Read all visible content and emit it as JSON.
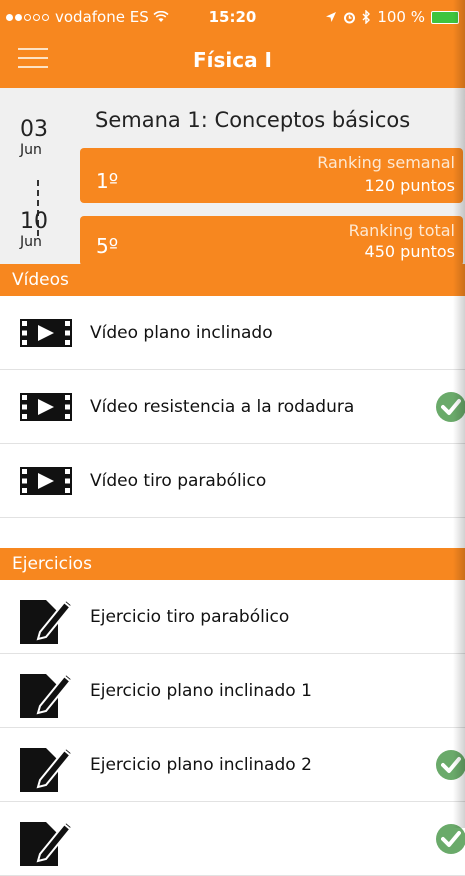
{
  "status_bar": {
    "carrier": "vodafone ES",
    "time": "15:20",
    "battery": "100 %"
  },
  "nav": {
    "title": "Física I"
  },
  "week": {
    "title": "Semana 1: Conceptos básicos",
    "start": {
      "day": "03",
      "month": "Jun"
    },
    "end": {
      "day": "10",
      "month": "Jun"
    },
    "weekly_ranking": {
      "position": "1º",
      "label": "Ranking semanal",
      "points": "120 puntos"
    },
    "total_ranking": {
      "position": "5º",
      "label": "Ranking total",
      "points": "450 puntos"
    }
  },
  "videos": {
    "header": "Vídeos",
    "items": [
      {
        "label": "Vídeo plano inclinado",
        "completed": false
      },
      {
        "label": "Vídeo resistencia a la rodadura",
        "completed": true
      },
      {
        "label": "Vídeo tiro parabólico",
        "completed": false
      }
    ]
  },
  "exercises": {
    "header": "Ejercicios",
    "items": [
      {
        "label": "Ejercicio tiro parabólico",
        "completed": false
      },
      {
        "label": "Ejercicio plano inclinado 1",
        "completed": false
      },
      {
        "label": "Ejercicio plano inclinado 2",
        "completed": true
      },
      {
        "label": "",
        "completed": true
      }
    ]
  },
  "colors": {
    "accent": "#f7871f",
    "check": "#6aaa6a"
  }
}
